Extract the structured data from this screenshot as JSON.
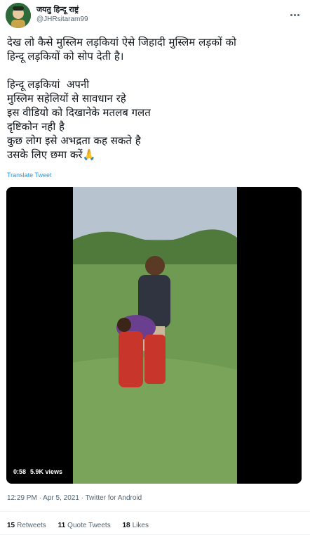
{
  "author": {
    "display_name": "जयतु हिन्दू राष्ट्रं",
    "handle": "@JHRsitaram99"
  },
  "tweet": {
    "text": "देख लो कैसे मुस्लिम लड़कियां ऐसे जिहादी मुस्लिम लड़कों को\nहिन्दू लड़कियों को सोप देती है।\n\nहिन्दू लड़कियां  अपनी\nमुस्लिम सहेलियों से सावधान रहे\nइस वीडियो को दिखानेके मतलब गलत\nदृष्टिकोन नही है\nकुछ लोग इसे अभद्रता कह सकते है\nउसके लिए छमा करें🙏",
    "translate_label": "Translate Tweet"
  },
  "video": {
    "duration": "0:58",
    "views": "5.9K views"
  },
  "meta": {
    "time": "12:29 PM",
    "separator": "·",
    "date": "Apr 5, 2021",
    "source": "Twitter for Android"
  },
  "stats": {
    "retweets_count": "15",
    "retweets_label": "Retweets",
    "quotes_count": "11",
    "quotes_label": "Quote Tweets",
    "likes_count": "18",
    "likes_label": "Likes"
  },
  "colors": {
    "link": "#1d9bf0",
    "secondary_text": "#536471"
  }
}
